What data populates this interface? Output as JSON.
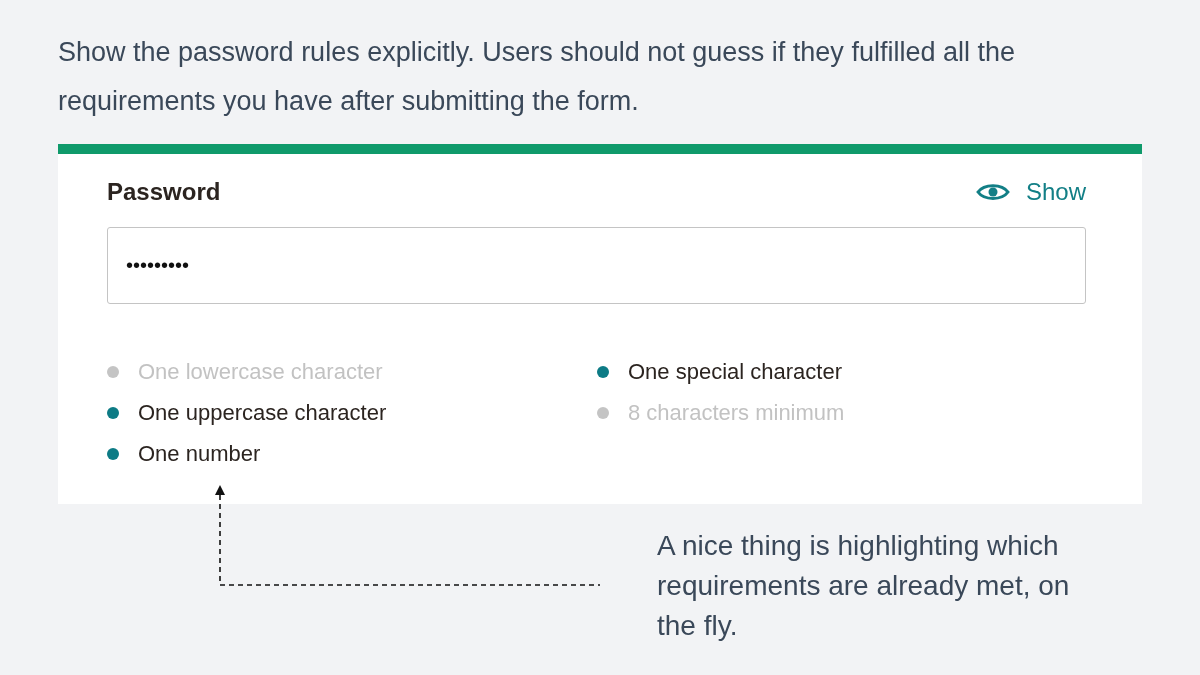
{
  "intro": "Show the password rules explicitly. Users should not guess if they fulfilled all the requirements you have after submitting the form.",
  "form": {
    "label": "Password",
    "toggle": {
      "label": "Show"
    },
    "field": {
      "value": "•••••••••"
    },
    "requirements": [
      {
        "label": "One lowercase character",
        "met": false
      },
      {
        "label": "One uppercase character",
        "met": true
      },
      {
        "label": "One number",
        "met": true
      },
      {
        "label": "One special character",
        "met": true
      },
      {
        "label": "8 characters minimum",
        "met": false
      }
    ]
  },
  "annotation": "A nice thing is highlighting which requirements are already met, on the fly."
}
